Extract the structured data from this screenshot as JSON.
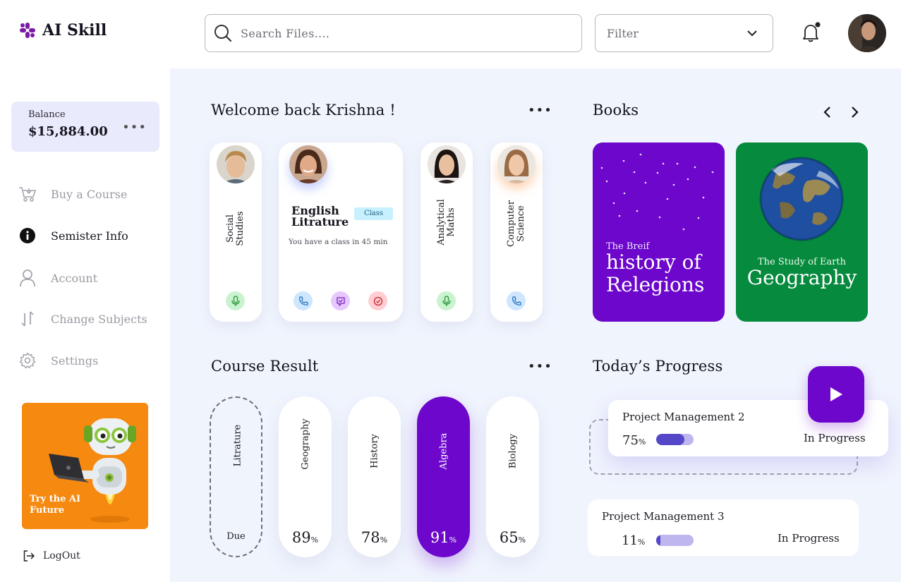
{
  "app": {
    "name": "AI Skill"
  },
  "header": {
    "search_placeholder": "Search Files....",
    "filter_label": "Filter"
  },
  "sidebar": {
    "balance_label": "Balance",
    "balance_value": "$15,884.00",
    "items": [
      {
        "label": "Buy a Course",
        "icon": "cart-icon",
        "active": false
      },
      {
        "label": "Semister Info",
        "icon": "info-icon",
        "active": true
      },
      {
        "label": "Account",
        "icon": "user-icon",
        "active": false
      },
      {
        "label": "Change Subjects",
        "icon": "swap-icon",
        "active": false
      },
      {
        "label": "Settings",
        "icon": "gear-icon",
        "active": false
      }
    ],
    "promo_text": "Try the AI Future",
    "logout_label": "LogOut"
  },
  "welcome": {
    "title": "Welcome back Krishna !",
    "cards": [
      {
        "subject": "Social Studies",
        "line1": "Social",
        "line2": "Studies",
        "actions": [
          "mic-icon"
        ]
      },
      {
        "subject": "English Litrature",
        "line1": "English",
        "line2": "Litrature",
        "badge": "Class",
        "note": "You have a class in 45 min",
        "actions": [
          "phone-icon",
          "chat-icon",
          "check-icon"
        ]
      },
      {
        "subject": "Analytical Maths",
        "line1": "Analytical",
        "line2": "Maths",
        "actions": [
          "mic-icon"
        ]
      },
      {
        "subject": "Computer Science",
        "line1": "Computer",
        "line2": "Science",
        "actions": [
          "phone-icon"
        ]
      }
    ]
  },
  "books": {
    "title": "Books",
    "items": [
      {
        "small": "The Breif",
        "big1": "history of",
        "big2": "Relegions",
        "color": "#6c07cb"
      },
      {
        "small": "The Study of Earth",
        "big1": "Geography",
        "big2": "",
        "color": "#068a3e"
      }
    ]
  },
  "course_result": {
    "title": "Course Result",
    "items": [
      {
        "subject": "Litrature",
        "value": "Due",
        "pct": "",
        "highlight": false,
        "dashed": true
      },
      {
        "subject": "Geography",
        "value": "89",
        "pct": "%",
        "highlight": false,
        "dashed": false
      },
      {
        "subject": "History",
        "value": "78",
        "pct": "%",
        "highlight": false,
        "dashed": false
      },
      {
        "subject": "Algebra",
        "value": "91",
        "pct": "%",
        "highlight": true,
        "dashed": false
      },
      {
        "subject": "Biology",
        "value": "65",
        "pct": "%",
        "highlight": false,
        "dashed": false
      }
    ]
  },
  "progress": {
    "title": "Today’s Progress",
    "items": [
      {
        "name": "Project Management 2",
        "value": "75",
        "pct": "%",
        "fraction": 0.75,
        "status": "In Progress"
      },
      {
        "name": "Project Management 3",
        "value": "11",
        "pct": "%",
        "fraction": 0.11,
        "status": "In Progress"
      }
    ]
  },
  "colors": {
    "accent": "#6c07cb",
    "green": "#068a3e",
    "orange": "#f6890f",
    "bar": "#5448c8"
  }
}
